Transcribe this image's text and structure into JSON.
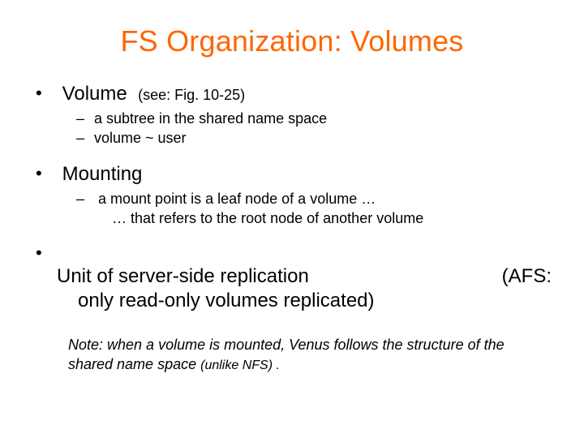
{
  "title": "FS Organization: Volumes",
  "bullets": {
    "b1": {
      "label": "Volume",
      "see": "(see: Fig. 10-25)",
      "sub1": "a subtree in the shared name space",
      "sub2": "volume ~ user"
    },
    "b2": {
      "label": "Mounting",
      "sub1": "a mount point is a leaf node of a volume …",
      "sub1_cont": "… that refers to the root node of another volume"
    },
    "b3": {
      "left": "Unit of server-side replication",
      "right": "(AFS:",
      "cont": "only read-only volumes replicated)"
    }
  },
  "note": {
    "prefix": "Note: when a volume is mounted, Venus follows the structure of the shared name space ",
    "small": "(unlike NFS) ."
  }
}
